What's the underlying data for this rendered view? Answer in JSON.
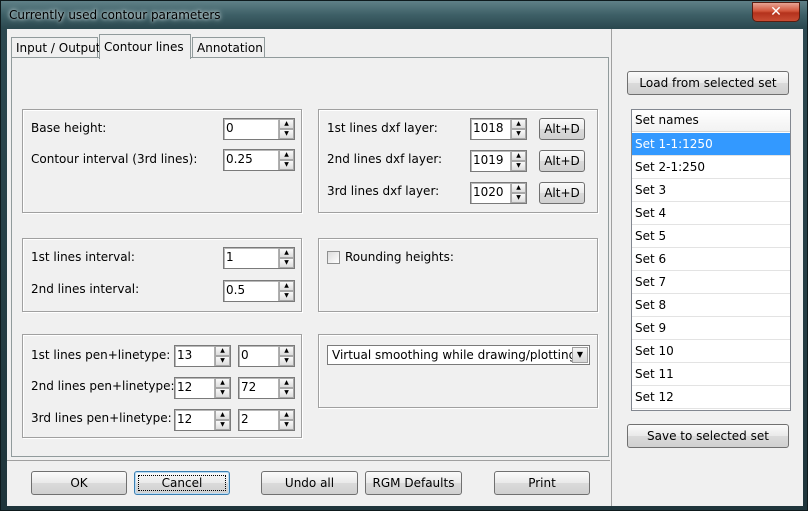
{
  "window": {
    "title": "Currently used contour parameters",
    "close_glyph": "✕"
  },
  "tabs": [
    {
      "label": "Input / Output",
      "active": false
    },
    {
      "label": "Contour lines",
      "active": true
    },
    {
      "label": "Annotation",
      "active": false
    }
  ],
  "heights": {
    "base_label": "Base height:",
    "base_value": "0",
    "interval_label": "Contour interval (3rd lines):",
    "interval_value": "0.25"
  },
  "dxf": {
    "rows": [
      {
        "label": "1st lines dxf layer:",
        "value": "1018",
        "button": "Alt+D"
      },
      {
        "label": "2nd lines dxf layer:",
        "value": "1019",
        "button": "Alt+D"
      },
      {
        "label": "3rd lines dxf layer:",
        "value": "1020",
        "button": "Alt+D"
      }
    ]
  },
  "intervals": {
    "first_label": "1st lines interval:",
    "first_value": "1",
    "second_label": "2nd lines interval:",
    "second_value": "0.5"
  },
  "rounding": {
    "label": "Rounding heights:",
    "checked": false
  },
  "pens": {
    "rows": [
      {
        "label": "1st lines pen+linetype:",
        "pen": "13",
        "linetype": "0"
      },
      {
        "label": "2nd lines pen+linetype:",
        "pen": "12",
        "linetype": "72"
      },
      {
        "label": "3rd lines pen+linetype:",
        "pen": "12",
        "linetype": "2"
      }
    ]
  },
  "smoothing": {
    "selected": "Virtual smoothing while drawing/plotting"
  },
  "footer": {
    "ok": "OK",
    "cancel": "Cancel",
    "undo": "Undo all",
    "defaults": "RGM Defaults",
    "print": "Print"
  },
  "sets": {
    "load_button": "Load from selected set",
    "header": "Set names",
    "items": [
      "Set 1-1:1250",
      "Set 2-1:250",
      "Set 3",
      "Set 4",
      "Set 5",
      "Set 6",
      "Set 7",
      "Set 8",
      "Set 9",
      "Set 10",
      "Set 11",
      "Set 12"
    ],
    "selected_index": 0,
    "save_button": "Save to selected set"
  },
  "icons": {
    "spin_up": "up-arrow-icon",
    "spin_down": "down-arrow-icon",
    "dropdown": "chevron-down-icon"
  },
  "colors": {
    "selection": "#3399ff",
    "close_button": "#c94d34"
  }
}
